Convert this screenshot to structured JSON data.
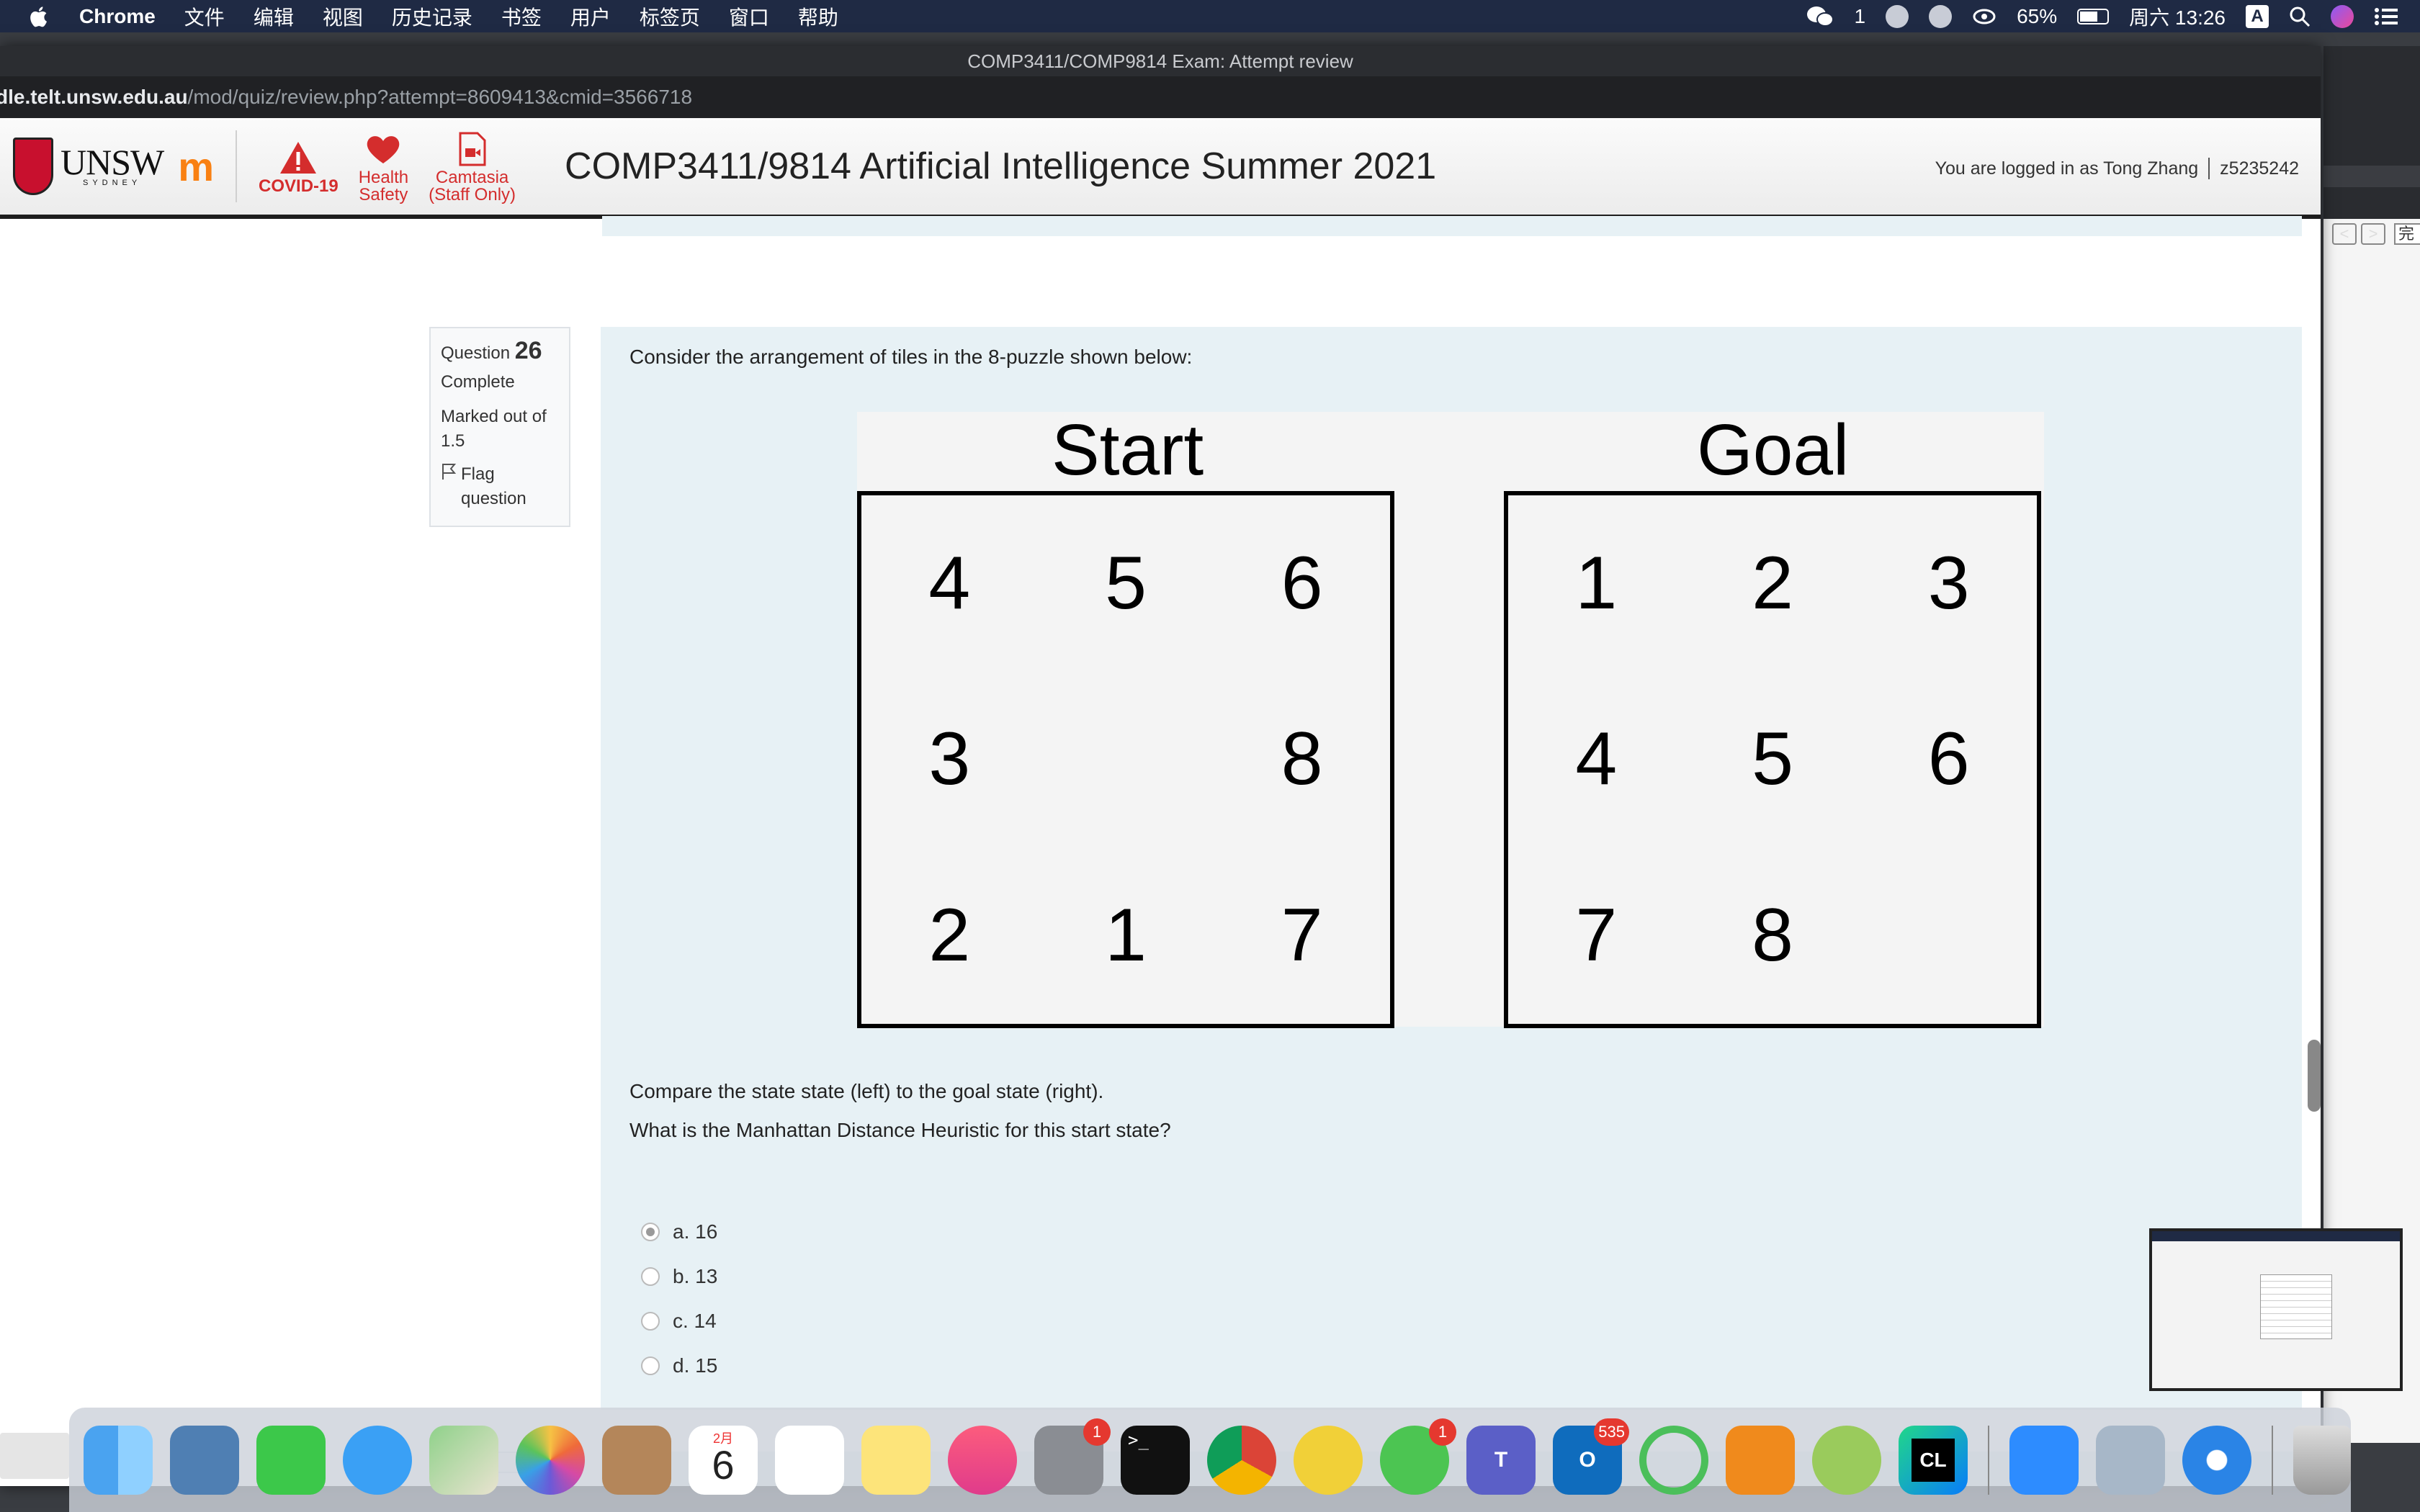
{
  "menubar": {
    "app": "Chrome",
    "items": [
      "文件",
      "编辑",
      "视图",
      "历史记录",
      "书签",
      "用户",
      "标签页",
      "窗口",
      "帮助"
    ],
    "wechat_count": "1",
    "battery": "65%",
    "battery_level": 0.65,
    "clock": "周六 13:26",
    "input_method": "A"
  },
  "browser": {
    "window_title": "COMP3411/COMP9814 Exam: Attempt review",
    "url_host": "dle.telt.unsw.edu.au",
    "url_path": "/mod/quiz/review.php?attempt=8609413&cmid=3566718"
  },
  "header": {
    "unsw_word": "UNSW",
    "unsw_sub": "SYDNEY",
    "moodle_mark": "m",
    "links": [
      {
        "label": "COVID-19"
      },
      {
        "label_line1": "Health",
        "label_line2": "Safety"
      },
      {
        "label_line1": "Camtasia",
        "label_line2": "(Staff Only)"
      }
    ],
    "course_title": "COMP3411/9814 Artificial Intelligence Summer 2021",
    "logged_in_text": "You are logged in as Tong Zhang",
    "user_id": "z5235242"
  },
  "question_info": {
    "label": "Question",
    "number": "26",
    "state": "Complete",
    "marked_line1": "Marked out of",
    "marked_line2": "1.5",
    "flag_line1": "Flag",
    "flag_line2": "question"
  },
  "question": {
    "intro": "Consider the arrangement of tiles in the 8-puzzle shown below:",
    "start_title": "Start",
    "goal_title": "Goal",
    "start_tiles": [
      "4",
      "5",
      "6",
      "3",
      "",
      "8",
      "2",
      "1",
      "7"
    ],
    "goal_tiles": [
      "1",
      "2",
      "3",
      "4",
      "5",
      "6",
      "7",
      "8",
      ""
    ],
    "compare_text": "Compare the state state (left) to the goal state (right).",
    "ask_text": "What is the Manhattan Distance Heuristic for this start state?",
    "options": [
      {
        "label": "a. 16",
        "checked": true
      },
      {
        "label": "b. 13",
        "checked": false
      },
      {
        "label": "c. 14",
        "checked": false
      },
      {
        "label": "d. 15",
        "checked": false
      }
    ]
  },
  "side_window": {
    "nav_prev": "<",
    "nav_next": ">",
    "edge_char": "完"
  },
  "dock": {
    "calendar_month": "2月",
    "calendar_day": "6",
    "terminal_glyph": ">_",
    "teams_letter": "T",
    "outlook_letter": "O",
    "clion_letters": "CL",
    "badges": {
      "system_prefs": "1",
      "wechat": "1",
      "outlook": "535"
    }
  }
}
